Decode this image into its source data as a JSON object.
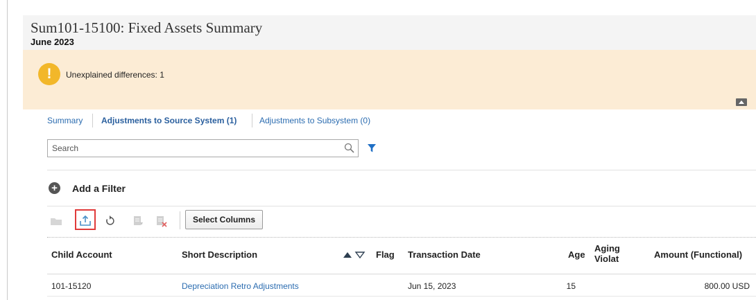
{
  "header": {
    "title": "Sum101-15100: Fixed Assets Summary",
    "period": "June 2023"
  },
  "banner": {
    "icon": "warning-icon",
    "message": "Unexplained differences: 1"
  },
  "tabs": [
    {
      "label": "Summary",
      "active": false
    },
    {
      "label": "Adjustments to Source System (1)",
      "active": true
    },
    {
      "label": "Adjustments to Subsystem (0)",
      "active": false
    }
  ],
  "search": {
    "placeholder": "Search",
    "value": ""
  },
  "filters": {
    "add_label": "Add a Filter"
  },
  "toolbar": {
    "icons": [
      "folder-icon",
      "export-icon",
      "refresh-icon",
      "edit-icon",
      "delete-icon"
    ],
    "select_columns_label": "Select Columns"
  },
  "table": {
    "columns": [
      {
        "key": "child_account",
        "label": "Child Account"
      },
      {
        "key": "short_description",
        "label": "Short Description"
      },
      {
        "key": "flag",
        "label": "Flag"
      },
      {
        "key": "transaction_date",
        "label": "Transaction Date"
      },
      {
        "key": "age",
        "label": "Age"
      },
      {
        "key": "aging_violation",
        "label_line1": "Aging",
        "label_line2": "Violat"
      },
      {
        "key": "amount_functional",
        "label": "Amount (Functional)"
      }
    ],
    "rows": [
      {
        "child_account": "101-15120",
        "short_description": "Depreciation Retro Adjustments",
        "flag": "",
        "transaction_date": "Jun 15, 2023",
        "age": "15",
        "aging_violation": "",
        "amount_functional": "800.00 USD"
      }
    ]
  },
  "colors": {
    "banner_bg": "#fcecd5",
    "header_bg": "#f4f4f4",
    "link": "#2b6cb0",
    "warning": "#f2b72a",
    "highlight": "#e03a3a"
  }
}
